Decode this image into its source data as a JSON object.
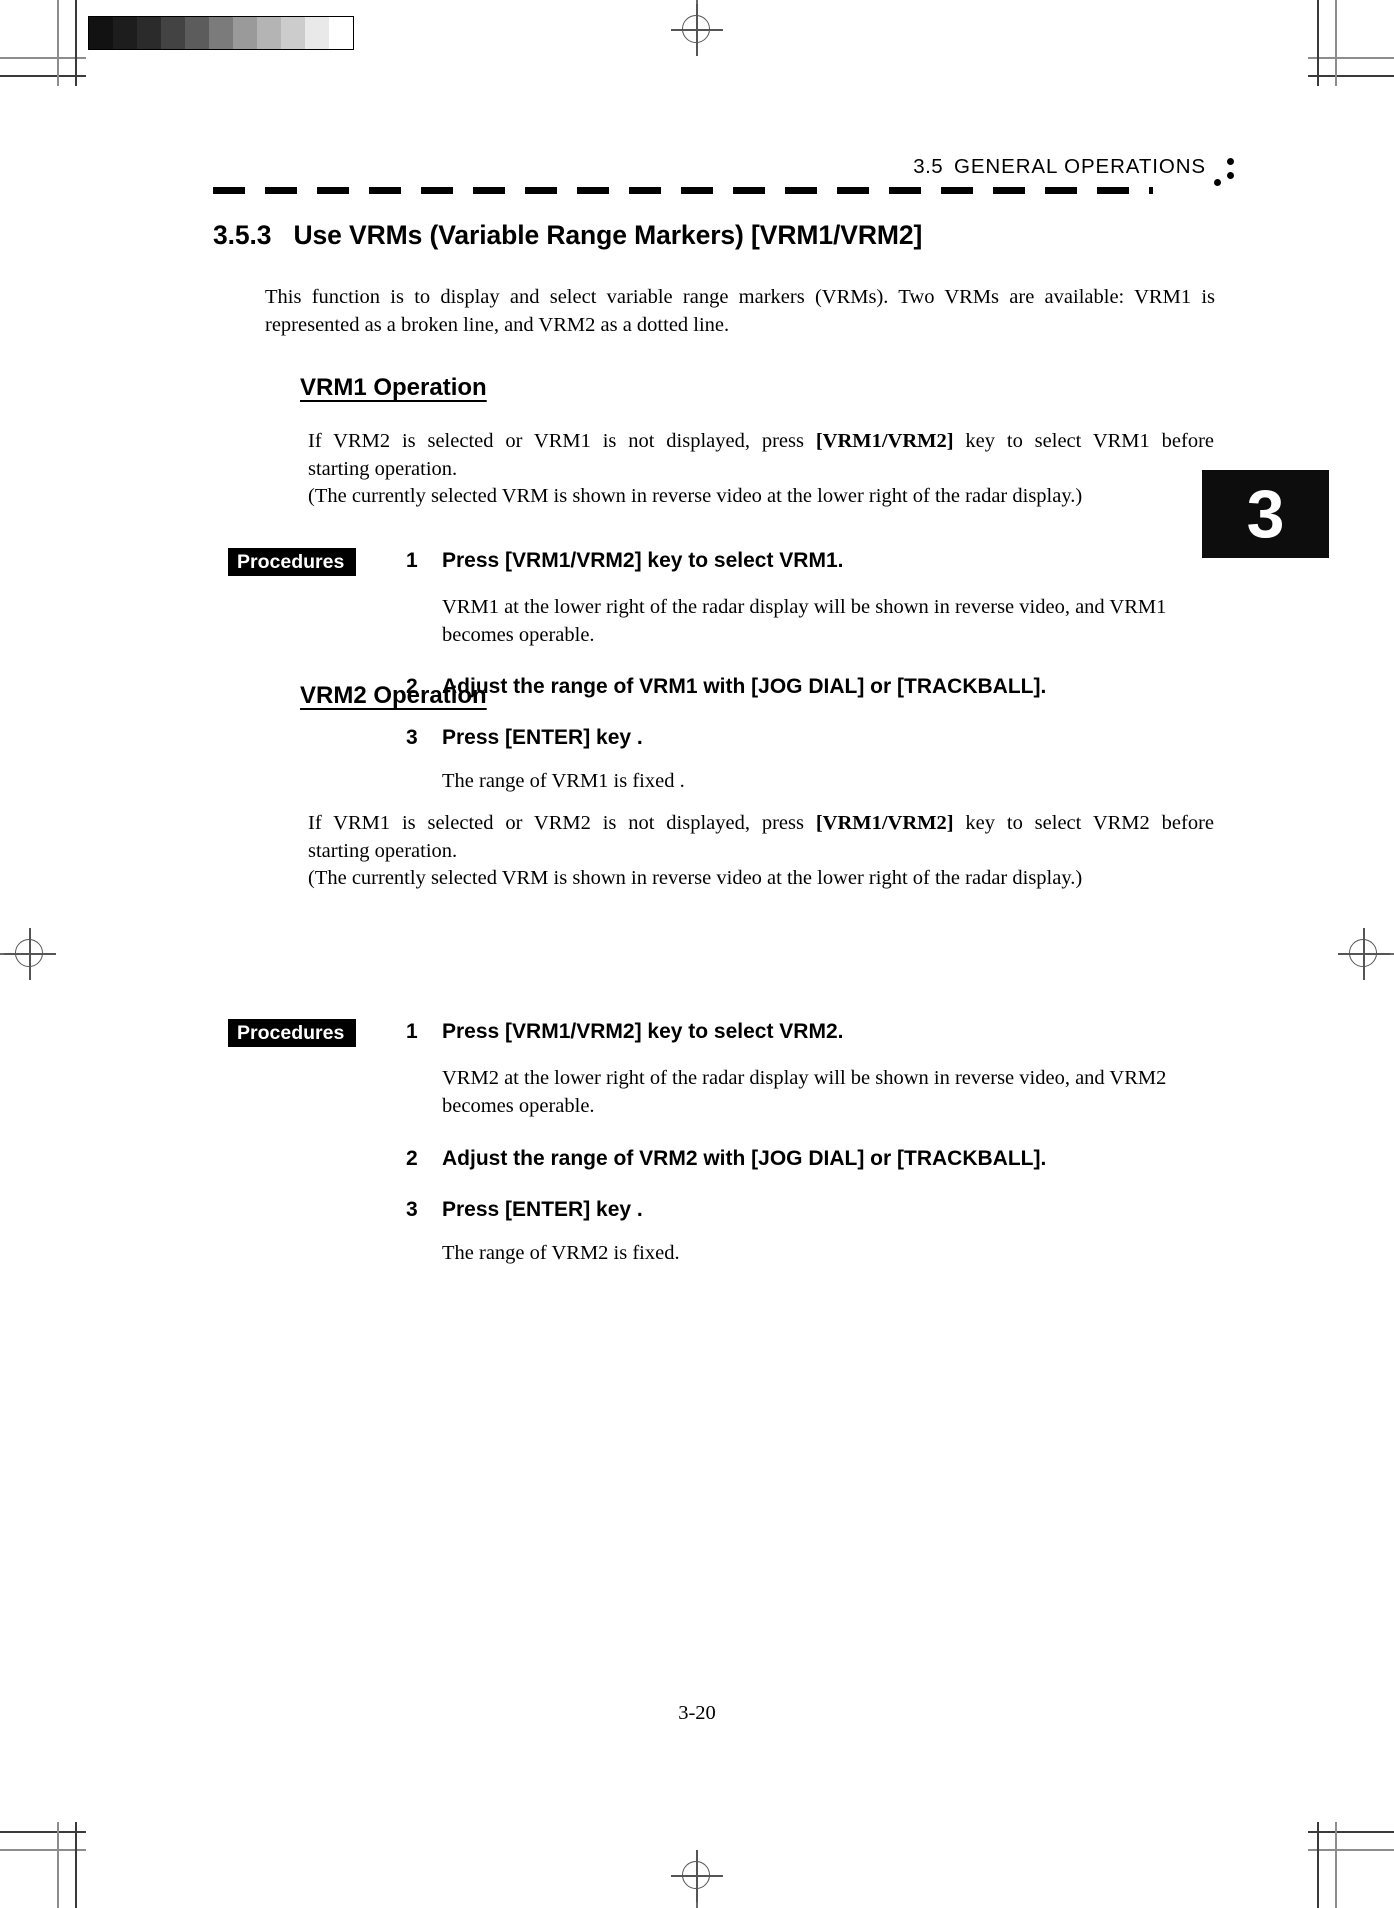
{
  "document": {
    "running_head": {
      "number": "3.5",
      "title": "GENERAL  OPERATIONS"
    },
    "chapter_tab": "3",
    "page_number": "3-20",
    "section": {
      "number": "3.5.3",
      "title": "Use VRMs (Variable Range Markers) [VRM1/VRM2]"
    },
    "intro": "This function is to display and select variable range markers (VRMs).   Two VRMs are available: VRM1 is represented as a broken line, and VRM2 as a dotted line.",
    "sections": [
      {
        "heading": "VRM1 Operation",
        "intro_line1_a": "If VRM2 is selected or VRM1 is not displayed, press ",
        "intro_line1_b": "[VRM1/VRM2]",
        "intro_line1_c": " key to select VRM1 before",
        "intro_line2": "starting operation.",
        "intro_line3": "(The currently selected VRM is shown in reverse video at the lower right of the radar display.)",
        "procedures_label": "Procedures",
        "steps": [
          {
            "number": "1",
            "text": "Press [VRM1/VRM2] key to select VRM1.",
            "note": "VRM1 at the lower right of the radar display will be shown in reverse video, and VRM1 becomes operable."
          },
          {
            "number": "2",
            "text": "Adjust the range of VRM1 with [JOG DIAL] or [TRACKBALL].",
            "note": ""
          },
          {
            "number": "3",
            "text": "Press [ENTER] key .",
            "note": "The range of VRM1 is fixed ."
          }
        ]
      },
      {
        "heading": "VRM2 Operation",
        "intro_line1_a": "If VRM1 is selected or VRM2 is not displayed, press ",
        "intro_line1_b": "[VRM1/VRM2]",
        "intro_line1_c": " key to select VRM2 before",
        "intro_line2": "starting operation.",
        "intro_line3": "(The currently selected VRM is shown in reverse video at the lower right of the radar display.)",
        "procedures_label": "Procedures",
        "steps": [
          {
            "number": "1",
            "text": "Press [VRM1/VRM2] key to select VRM2.",
            "note": "VRM2 at the lower right of the radar display will be shown in reverse video, and VRM2 becomes operable."
          },
          {
            "number": "2",
            "text": "Adjust the range of VRM2 with [JOG DIAL] or [TRACKBALL].",
            "note": ""
          },
          {
            "number": "3",
            "text": "Press [ENTER] key .",
            "note": "The range of VRM2 is fixed."
          }
        ]
      }
    ],
    "grayscale_strip": {
      "name": "grayscale-calibration-strip",
      "swatches": [
        "#121212",
        "#1d1d1d",
        "#2b2b2b",
        "#434343",
        "#5c5c5c",
        "#7b7b7b",
        "#9a9a9a",
        "#b4b4b4",
        "#cccccc",
        "#e9e9e9",
        "#ffffff"
      ]
    }
  }
}
